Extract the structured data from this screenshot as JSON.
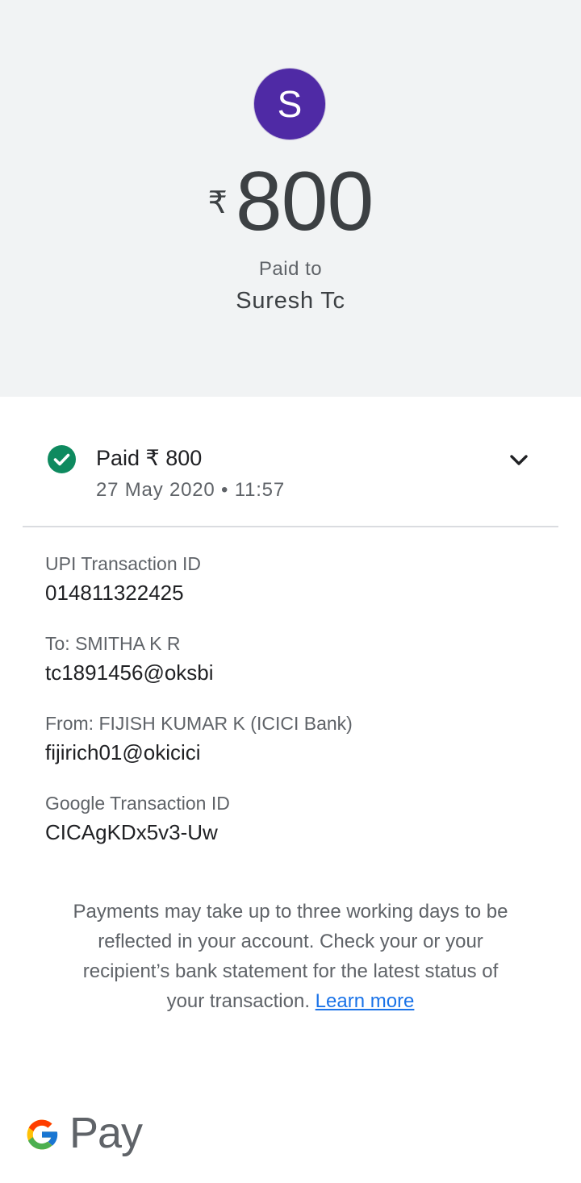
{
  "header": {
    "avatar_letter": "S",
    "avatar_color": "#4f2aa5",
    "currency_symbol": "₹",
    "amount": "800",
    "paid_to_label": "Paid to",
    "payee_name": "Suresh Tc"
  },
  "status": {
    "icon": "check-circle-icon",
    "title": "Paid ₹ 800",
    "datetime": "27 May 2020 • 11:57",
    "expand_icon": "chevron-down-icon",
    "success_color": "#0e8a5f"
  },
  "details": {
    "upi_label": "UPI Transaction ID",
    "upi_value": "014811322425",
    "to_label": "To: SMITHA K R",
    "to_value": "tc1891456@oksbi",
    "from_label": "From: FIJISH KUMAR K (ICICI Bank)",
    "from_value": "fijirich01@okicici",
    "google_label": "Google Transaction ID",
    "google_value": "CICAgKDx5v3-Uw"
  },
  "notice": {
    "text": "Payments may take up to three working days to be reflected in your account. Check your or your recipient’s bank statement for the latest status of your transaction.",
    "link_label": "Learn more",
    "link_color": "#1a73e8"
  },
  "footer": {
    "logo": "google-g-logo",
    "pay_label": "Pay"
  }
}
